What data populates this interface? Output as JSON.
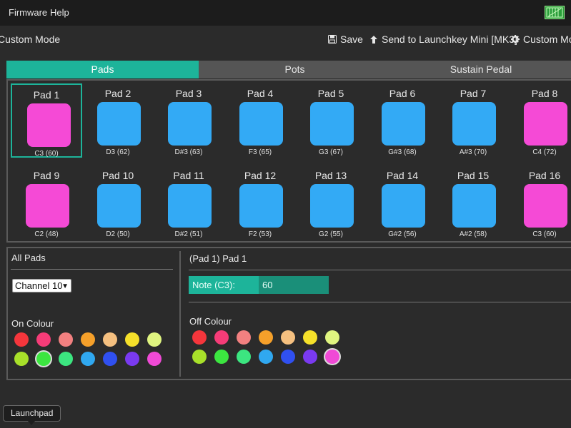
{
  "menu": {
    "firmware": "Firmware",
    "help": "Help"
  },
  "header": {
    "title": "Custom Mode",
    "save": "Save",
    "send": "Send to Launchkey Mini [MK3]",
    "modes": "Custom Mod"
  },
  "tabs": [
    {
      "label": "Pads",
      "active": true
    },
    {
      "label": "Pots",
      "active": false
    },
    {
      "label": "Sustain Pedal",
      "active": false
    }
  ],
  "pads": [
    {
      "name": "Pad 1",
      "note": "C3 (60)",
      "color": "#f54ad6",
      "selected": true
    },
    {
      "name": "Pad 2",
      "note": "D3 (62)",
      "color": "#33aaf5"
    },
    {
      "name": "Pad 3",
      "note": "D#3 (63)",
      "color": "#33aaf5"
    },
    {
      "name": "Pad 4",
      "note": "F3 (65)",
      "color": "#33aaf5"
    },
    {
      "name": "Pad 5",
      "note": "G3 (67)",
      "color": "#33aaf5"
    },
    {
      "name": "Pad 6",
      "note": "G#3 (68)",
      "color": "#33aaf5"
    },
    {
      "name": "Pad 7",
      "note": "A#3 (70)",
      "color": "#33aaf5"
    },
    {
      "name": "Pad 8",
      "note": "C4 (72)",
      "color": "#f54ad6"
    },
    {
      "name": "Pad 9",
      "note": "C2 (48)",
      "color": "#f54ad6"
    },
    {
      "name": "Pad 10",
      "note": "D2 (50)",
      "color": "#33aaf5"
    },
    {
      "name": "Pad 11",
      "note": "D#2 (51)",
      "color": "#33aaf5"
    },
    {
      "name": "Pad 12",
      "note": "F2 (53)",
      "color": "#33aaf5"
    },
    {
      "name": "Pad 13",
      "note": "G2 (55)",
      "color": "#33aaf5"
    },
    {
      "name": "Pad 14",
      "note": "G#2 (56)",
      "color": "#33aaf5"
    },
    {
      "name": "Pad 15",
      "note": "A#2 (58)",
      "color": "#33aaf5"
    },
    {
      "name": "Pad 16",
      "note": "C3 (60)",
      "color": "#f54ad6"
    }
  ],
  "all_pads": {
    "title": "All Pads",
    "channel": "Channel 10",
    "on_colour_label": "On Colour",
    "on_colours": [
      "#f5363c",
      "#f53c78",
      "#f28080",
      "#f5a02a",
      "#f5c080",
      "#f5e02a",
      "#e0f580",
      "#a8e02a",
      "#3ce640",
      "#3ce680",
      "#30a8f0",
      "#3050f0",
      "#7a3af0",
      "#f04ad6"
    ],
    "on_selected": 8
  },
  "pad_detail": {
    "title": "(Pad 1) Pad 1",
    "note_label": "Note (C3):",
    "note_value": "60",
    "off_colour_label": "Off Colour",
    "off_colours": [
      "#f5363c",
      "#f53c78",
      "#f28080",
      "#f5a02a",
      "#f5c080",
      "#f5e02a",
      "#e0f580",
      "#a8e02a",
      "#3ce640",
      "#3ce680",
      "#30a8f0",
      "#3050f0",
      "#7a3af0",
      "#f04ad6"
    ],
    "off_selected": 13
  },
  "tooltip": "Launchpad"
}
